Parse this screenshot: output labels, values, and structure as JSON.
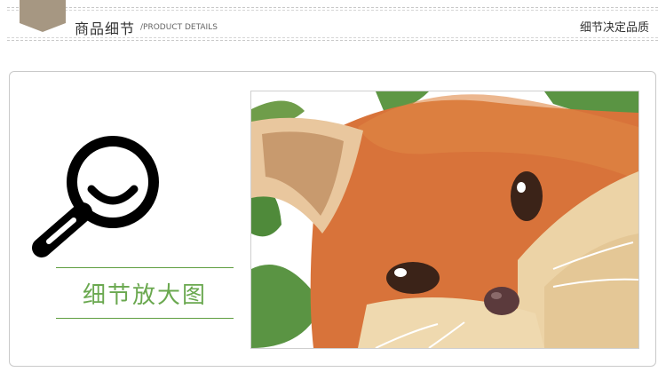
{
  "header": {
    "title": "商品细节",
    "subtitle": "/PRODUCT DETAILS",
    "right_text": "细节决定品质",
    "tag_color": "#a69782"
  },
  "detail": {
    "label": "细节放大图",
    "label_color": "#6aa84f",
    "icon": "magnifier-smile-icon"
  },
  "photo": {
    "subject": "fox-illustration"
  }
}
